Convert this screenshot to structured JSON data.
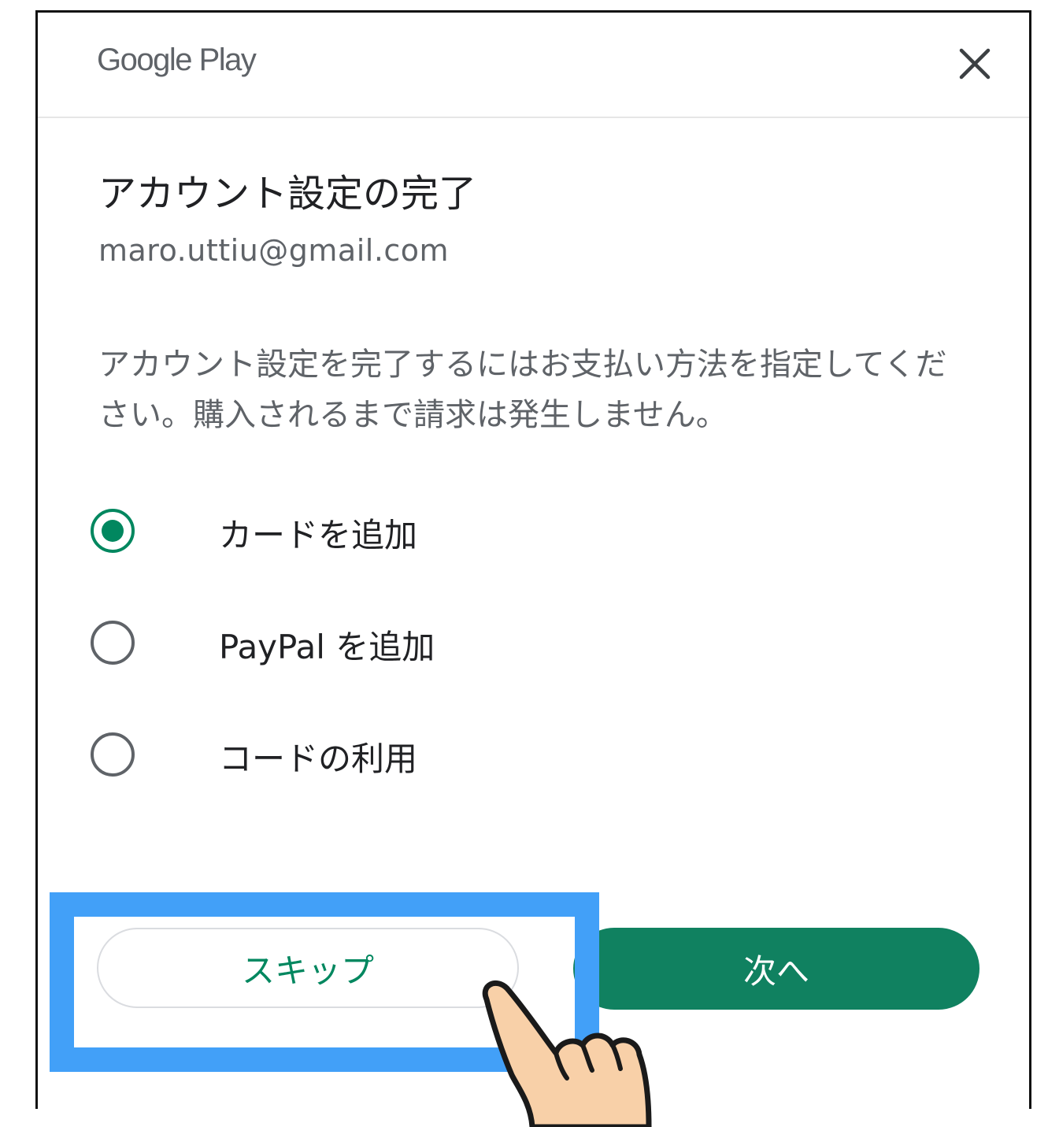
{
  "header": {
    "logo_text": "Google Play",
    "close_icon": "close-icon"
  },
  "main": {
    "title": "アカウント設定の完了",
    "email": "maro.uttiu@gmail.com",
    "description": "アカウント設定を完了するにはお支払い方法を指定してください。購入されるまで請求は発生しません。",
    "options": [
      {
        "label": "カードを追加",
        "selected": true
      },
      {
        "label": "PayPal を追加",
        "selected": false
      },
      {
        "label": "コードの利用",
        "selected": false
      }
    ]
  },
  "footer": {
    "skip_label": "スキップ",
    "next_label": "次へ"
  },
  "colors": {
    "accent_green": "#01875f",
    "highlight_blue": "#42a0f8",
    "hand_skin": "#f8d0a8"
  },
  "annotation": {
    "pointer_icon": "pointing-hand-icon"
  }
}
